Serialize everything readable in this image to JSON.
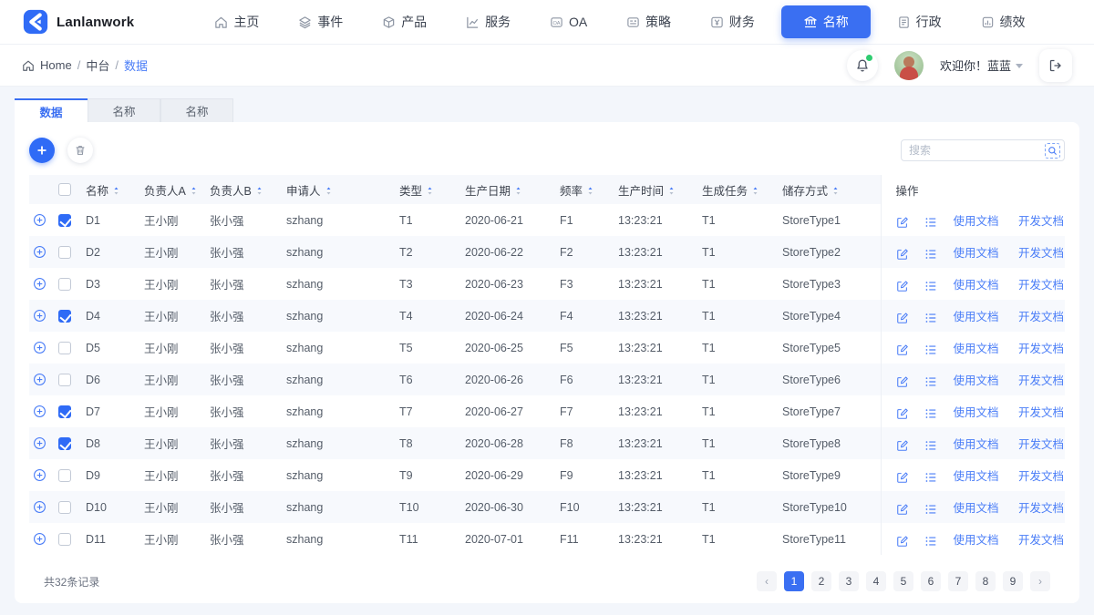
{
  "brand": {
    "name": "Lanlanwork"
  },
  "nav": {
    "items": [
      {
        "label": "主页",
        "icon": "home-icon",
        "active": false
      },
      {
        "label": "事件",
        "icon": "layers-icon",
        "active": false
      },
      {
        "label": "产品",
        "icon": "box-icon",
        "active": false
      },
      {
        "label": "服务",
        "icon": "chart-icon",
        "active": false
      },
      {
        "label": "OA",
        "icon": "oa-icon",
        "active": false
      },
      {
        "label": "策略",
        "icon": "card-icon",
        "active": false
      },
      {
        "label": "财务",
        "icon": "yen-icon",
        "active": false
      },
      {
        "label": "名称",
        "icon": "bank-icon",
        "active": true
      },
      {
        "label": "行政",
        "icon": "doc-icon",
        "active": false
      },
      {
        "label": "绩效",
        "icon": "report-icon",
        "active": false
      }
    ]
  },
  "breadcrumb": {
    "items": [
      "Home",
      "中台",
      "数据"
    ],
    "separator": "/"
  },
  "user": {
    "welcome": "欢迎你！蓝蓝"
  },
  "tabs": [
    {
      "label": "数据",
      "active": true
    },
    {
      "label": "名称",
      "active": false
    },
    {
      "label": "名称",
      "active": false
    }
  ],
  "search": {
    "placeholder": "搜索"
  },
  "table": {
    "columns": [
      "名称",
      "负责人A",
      "负责人B",
      "申请人",
      "类型",
      "生产日期",
      "频率",
      "生产时间",
      "生成任务",
      "储存方式"
    ],
    "actions_header": "操作",
    "action_links": [
      "使用文档",
      "开发文档"
    ],
    "rows": [
      {
        "name": "D1",
        "owner_a": "王小刚",
        "owner_b": "张小强",
        "applicant": "szhang",
        "type": "T1",
        "date": "2020-06-21",
        "freq": "F1",
        "time": "13:23:21",
        "task": "T1",
        "store": "StoreType1",
        "checked": true
      },
      {
        "name": "D2",
        "owner_a": "王小刚",
        "owner_b": "张小强",
        "applicant": "szhang",
        "type": "T2",
        "date": "2020-06-22",
        "freq": "F2",
        "time": "13:23:21",
        "task": "T1",
        "store": "StoreType2",
        "checked": false
      },
      {
        "name": "D3",
        "owner_a": "王小刚",
        "owner_b": "张小强",
        "applicant": "szhang",
        "type": "T3",
        "date": "2020-06-23",
        "freq": "F3",
        "time": "13:23:21",
        "task": "T1",
        "store": "StoreType3",
        "checked": false
      },
      {
        "name": "D4",
        "owner_a": "王小刚",
        "owner_b": "张小强",
        "applicant": "szhang",
        "type": "T4",
        "date": "2020-06-24",
        "freq": "F4",
        "time": "13:23:21",
        "task": "T1",
        "store": "StoreType4",
        "checked": true
      },
      {
        "name": "D5",
        "owner_a": "王小刚",
        "owner_b": "张小强",
        "applicant": "szhang",
        "type": "T5",
        "date": "2020-06-25",
        "freq": "F5",
        "time": "13:23:21",
        "task": "T1",
        "store": "StoreType5",
        "checked": false
      },
      {
        "name": "D6",
        "owner_a": "王小刚",
        "owner_b": "张小强",
        "applicant": "szhang",
        "type": "T6",
        "date": "2020-06-26",
        "freq": "F6",
        "time": "13:23:21",
        "task": "T1",
        "store": "StoreType6",
        "checked": false
      },
      {
        "name": "D7",
        "owner_a": "王小刚",
        "owner_b": "张小强",
        "applicant": "szhang",
        "type": "T7",
        "date": "2020-06-27",
        "freq": "F7",
        "time": "13:23:21",
        "task": "T1",
        "store": "StoreType7",
        "checked": true
      },
      {
        "name": "D8",
        "owner_a": "王小刚",
        "owner_b": "张小强",
        "applicant": "szhang",
        "type": "T8",
        "date": "2020-06-28",
        "freq": "F8",
        "time": "13:23:21",
        "task": "T1",
        "store": "StoreType8",
        "checked": true
      },
      {
        "name": "D9",
        "owner_a": "王小刚",
        "owner_b": "张小强",
        "applicant": "szhang",
        "type": "T9",
        "date": "2020-06-29",
        "freq": "F9",
        "time": "13:23:21",
        "task": "T1",
        "store": "StoreType9",
        "checked": false
      },
      {
        "name": "D10",
        "owner_a": "王小刚",
        "owner_b": "张小强",
        "applicant": "szhang",
        "type": "T10",
        "date": "2020-06-30",
        "freq": "F10",
        "time": "13:23:21",
        "task": "T1",
        "store": "StoreType10",
        "checked": false
      },
      {
        "name": "D11",
        "owner_a": "王小刚",
        "owner_b": "张小强",
        "applicant": "szhang",
        "type": "T11",
        "date": "2020-07-01",
        "freq": "F11",
        "time": "13:23:21",
        "task": "T1",
        "store": "StoreType11",
        "checked": false
      }
    ]
  },
  "footer": {
    "total": "共32条记录",
    "prev": "‹",
    "next": "›",
    "pages": [
      "1",
      "2",
      "3",
      "4",
      "5",
      "6",
      "7",
      "8",
      "9"
    ],
    "active_page": "1"
  },
  "colors": {
    "primary": "#3a6ff2",
    "link": "#4a7df7",
    "header_bg": "#f6f8fc",
    "stripe": "#f7f9fd"
  }
}
